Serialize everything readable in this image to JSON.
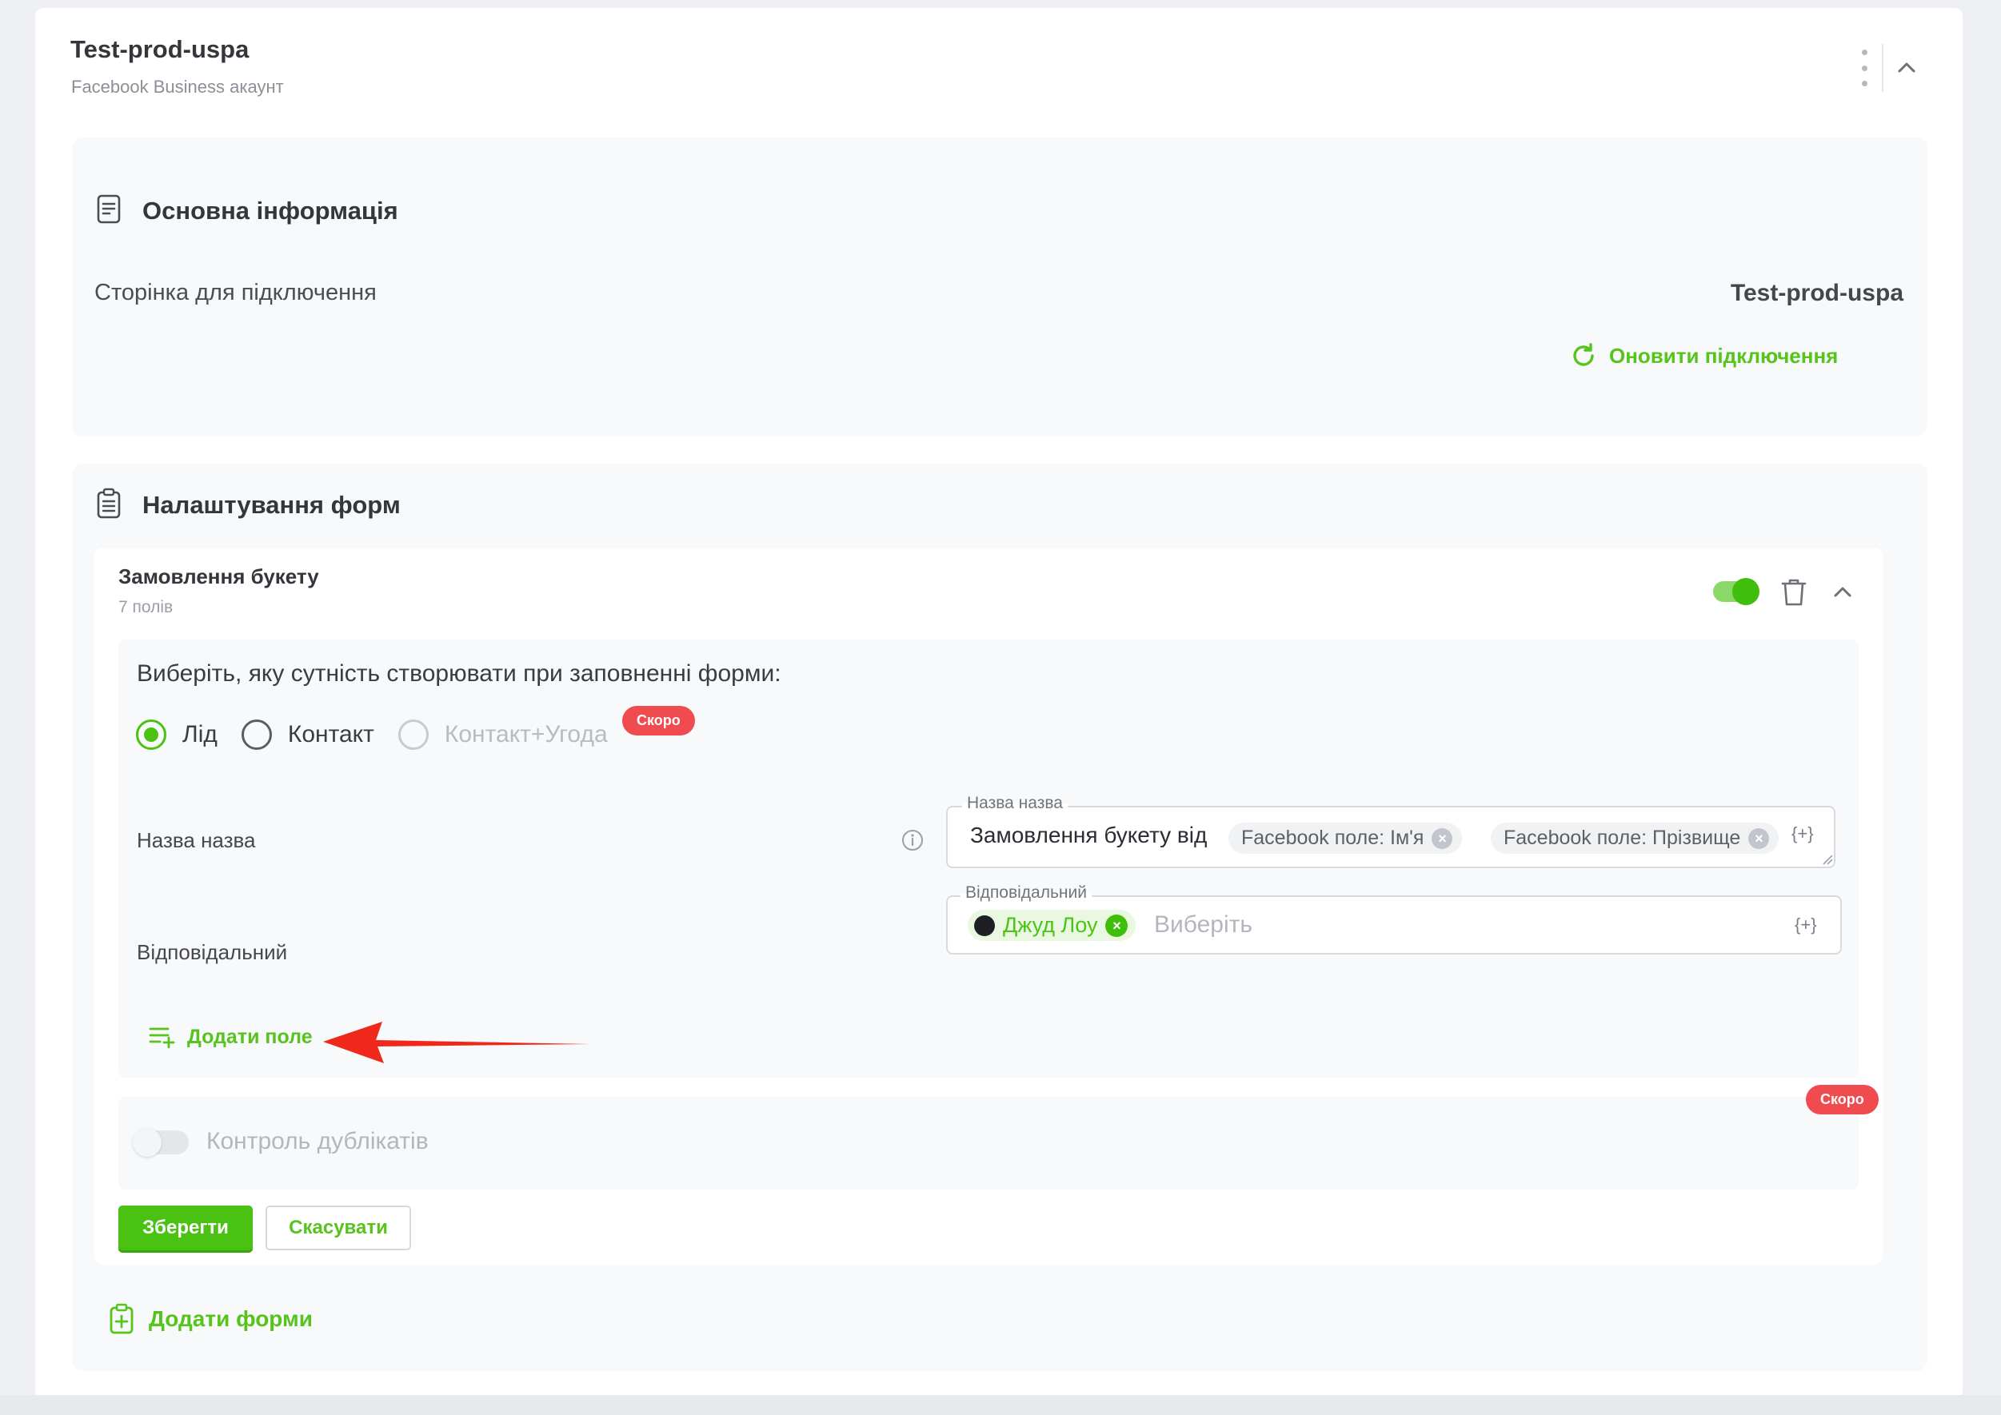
{
  "account": {
    "title": "Test-prod-uspa",
    "subtitle": "Facebook Business акаунт"
  },
  "basic_info": {
    "title": "Основна інформація",
    "page_label": "Сторінка для підключення",
    "page_value": "Test-prod-uspa",
    "refresh_label": "Оновити підключення"
  },
  "forms_settings": {
    "title": "Налаштування форм",
    "add_forms_label": "Додати форми"
  },
  "form": {
    "title": "Замовлення букету",
    "fields_count": "7 полів",
    "enabled": true,
    "entity_question": "Виберіть, яку сутність створювати при заповненні форми:",
    "entity_options": [
      {
        "label": "Лід",
        "selected": true,
        "disabled": false
      },
      {
        "label": "Контакт",
        "selected": false,
        "disabled": false
      },
      {
        "label": "Контакт+Угода",
        "selected": false,
        "disabled": true
      }
    ],
    "soon_badge": "Скоро",
    "name_row": {
      "label": "Назва назва",
      "legend": "Назва назва",
      "text": "Замовлення букету від",
      "chips": [
        "Facebook поле: Ім'я",
        "Facebook поле: Прізвище"
      ],
      "var_button": "{+}"
    },
    "responsible_row": {
      "label": "Відповідальний",
      "legend": "Відповідальний",
      "user": "Джуд Лоу",
      "placeholder": "Виберіть",
      "var_button": "{+}"
    },
    "add_field_label": "Додати поле",
    "duplicates": {
      "label": "Контроль дублікатів",
      "enabled": false,
      "badge": "Скоро"
    },
    "save_label": "Зберегти",
    "cancel_label": "Скасувати"
  },
  "colors": {
    "accent_green": "#49c213",
    "badge_red": "#f04b4f",
    "annotation_arrow": "#f0281c"
  },
  "icons": [
    "kebab-menu-icon",
    "chevron-up-icon",
    "document-icon",
    "refresh-icon",
    "clipboard-icon",
    "trash-icon",
    "info-icon",
    "add-list-icon",
    "close-icon",
    "clipboard-plus-icon",
    "red-arrow-annotation"
  ]
}
